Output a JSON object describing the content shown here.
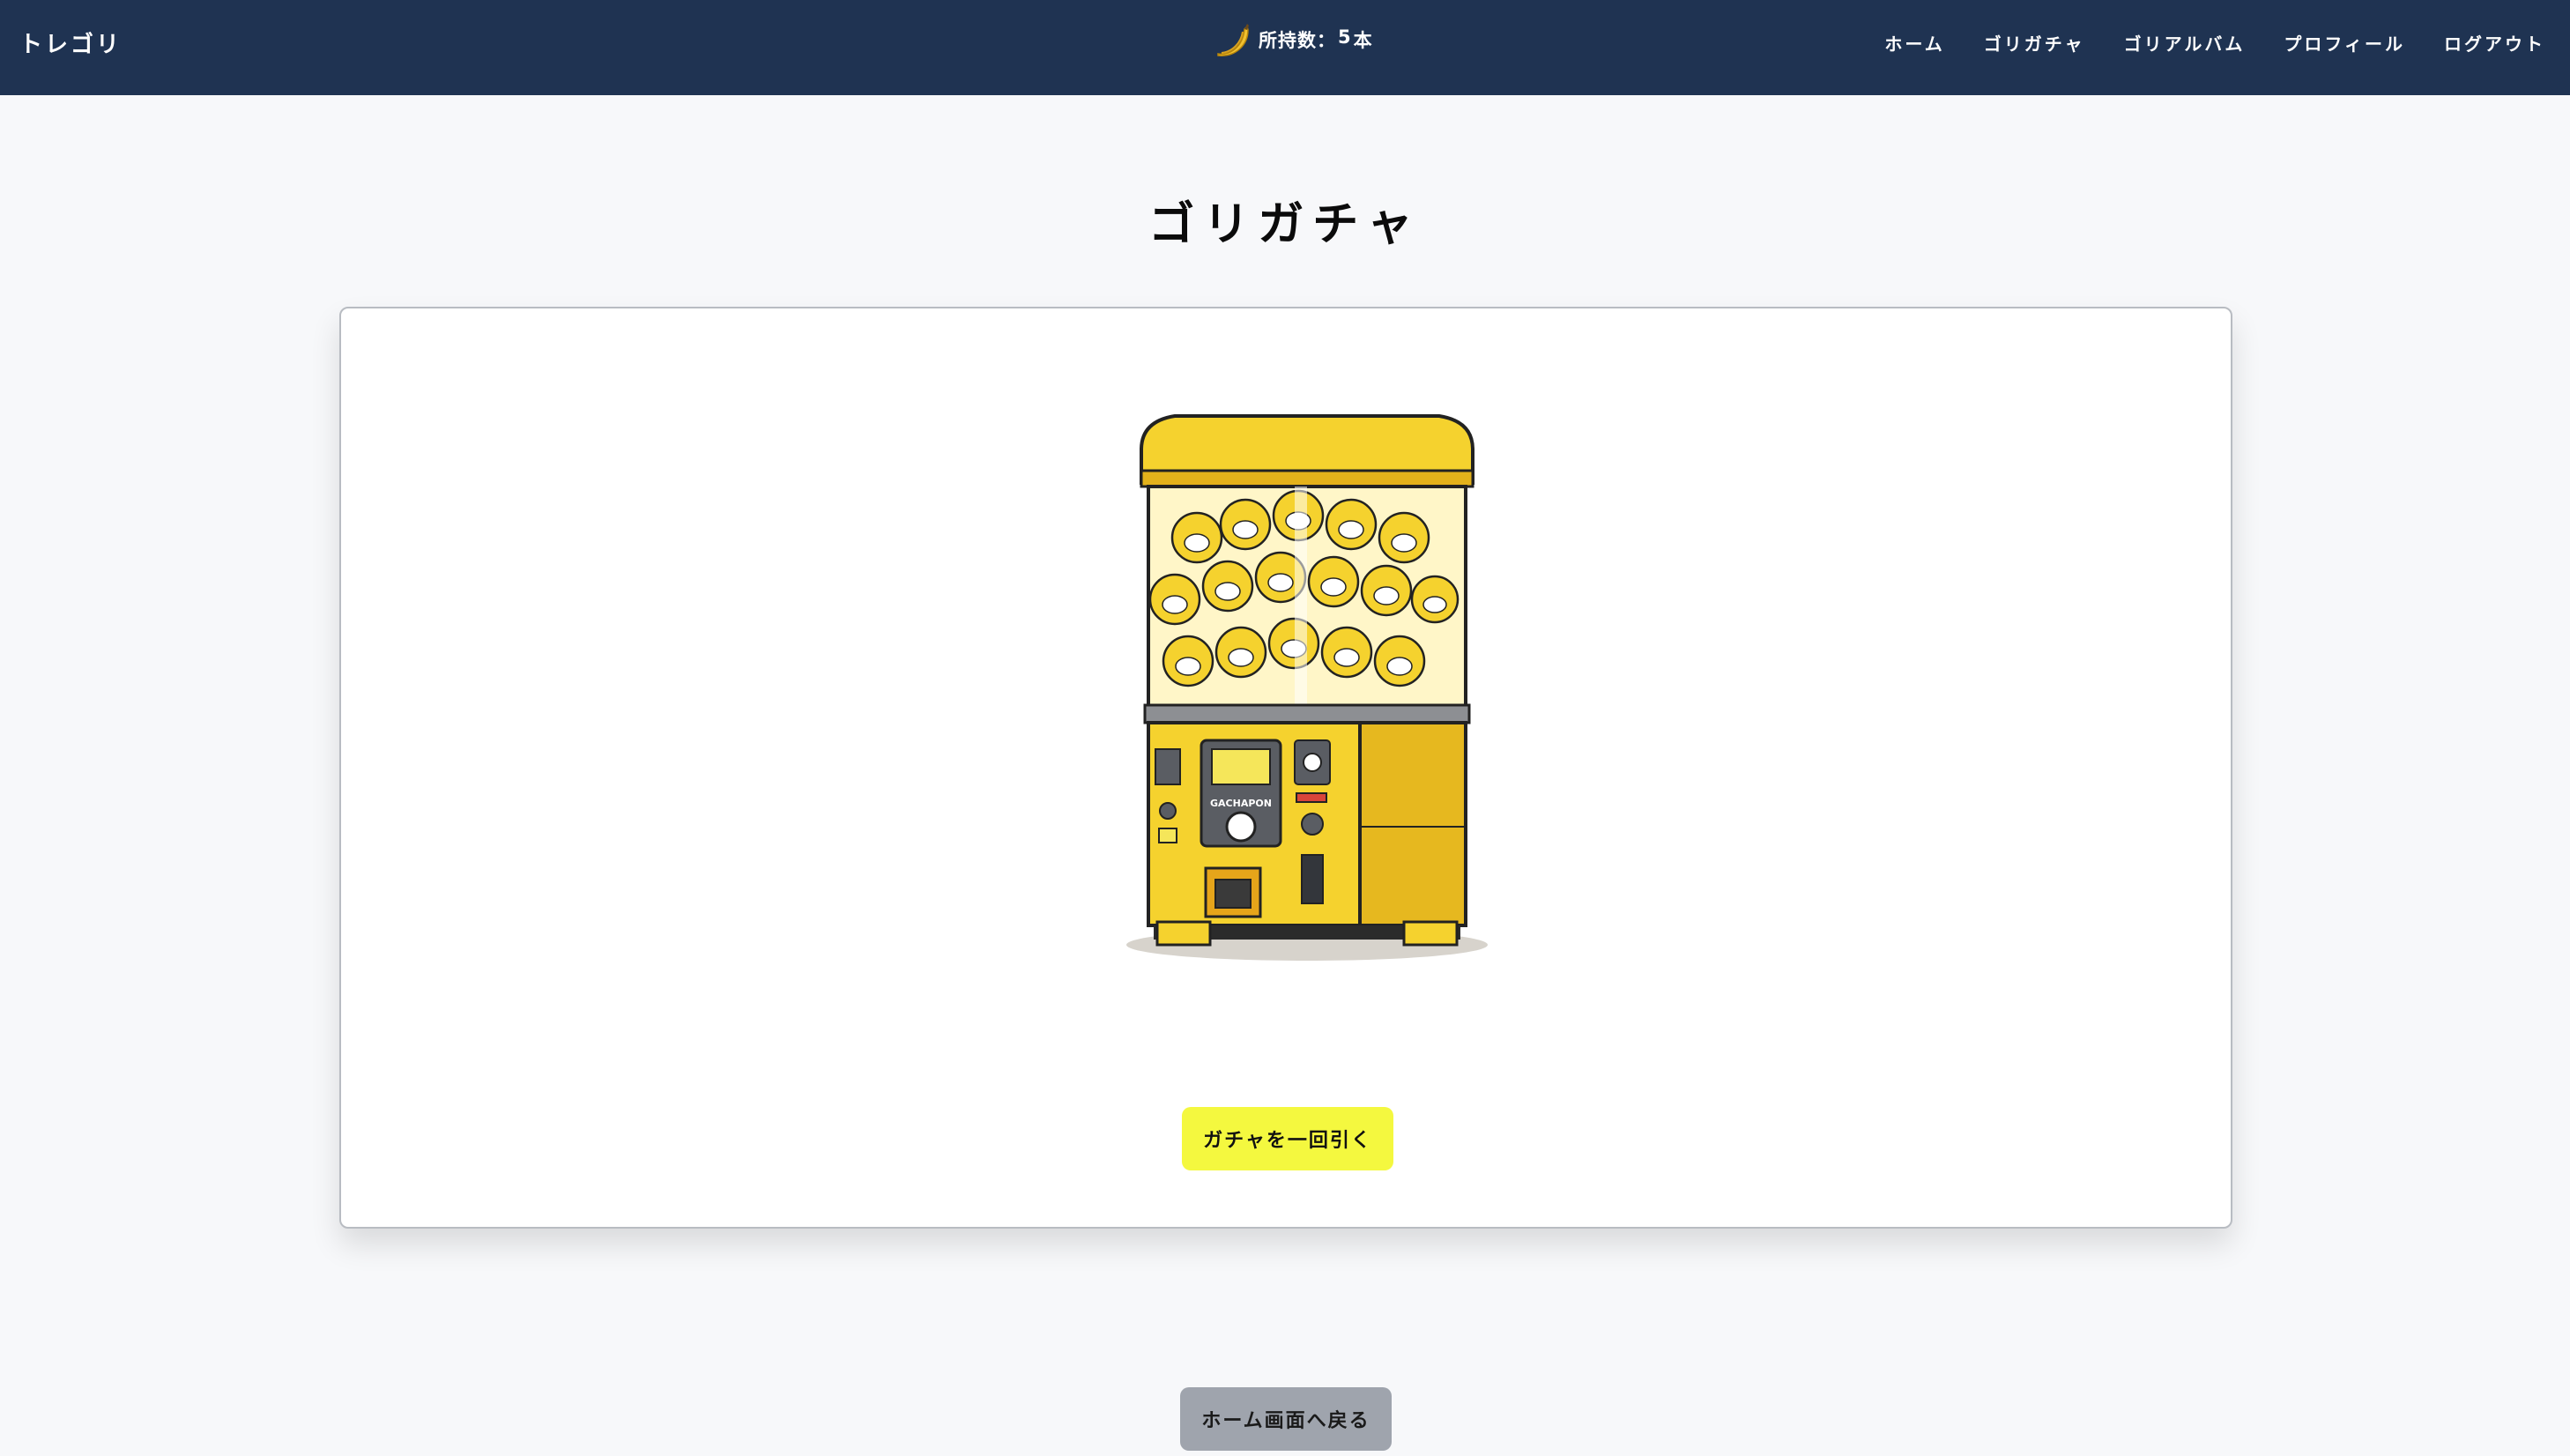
{
  "navbar": {
    "brand": "トレゴリ",
    "balance": {
      "label": "所持数：",
      "count": "5",
      "unit": "本",
      "icon": "banana-icon"
    },
    "links": [
      {
        "label": "ホーム"
      },
      {
        "label": "ゴリガチャ"
      },
      {
        "label": "ゴリアルバム"
      },
      {
        "label": "プロフィール"
      },
      {
        "label": "ログアウト"
      }
    ]
  },
  "main": {
    "title": "ゴリガチャ",
    "machine_label": "GACHAPON",
    "draw_button": "ガチャを一回引く",
    "back_button": "ホーム画面へ戻る"
  },
  "colors": {
    "navbar": "#1f3352",
    "draw_button": "#f4f83f",
    "back_button": "#9fa4ad",
    "machine_yellow": "#f5d22e"
  }
}
